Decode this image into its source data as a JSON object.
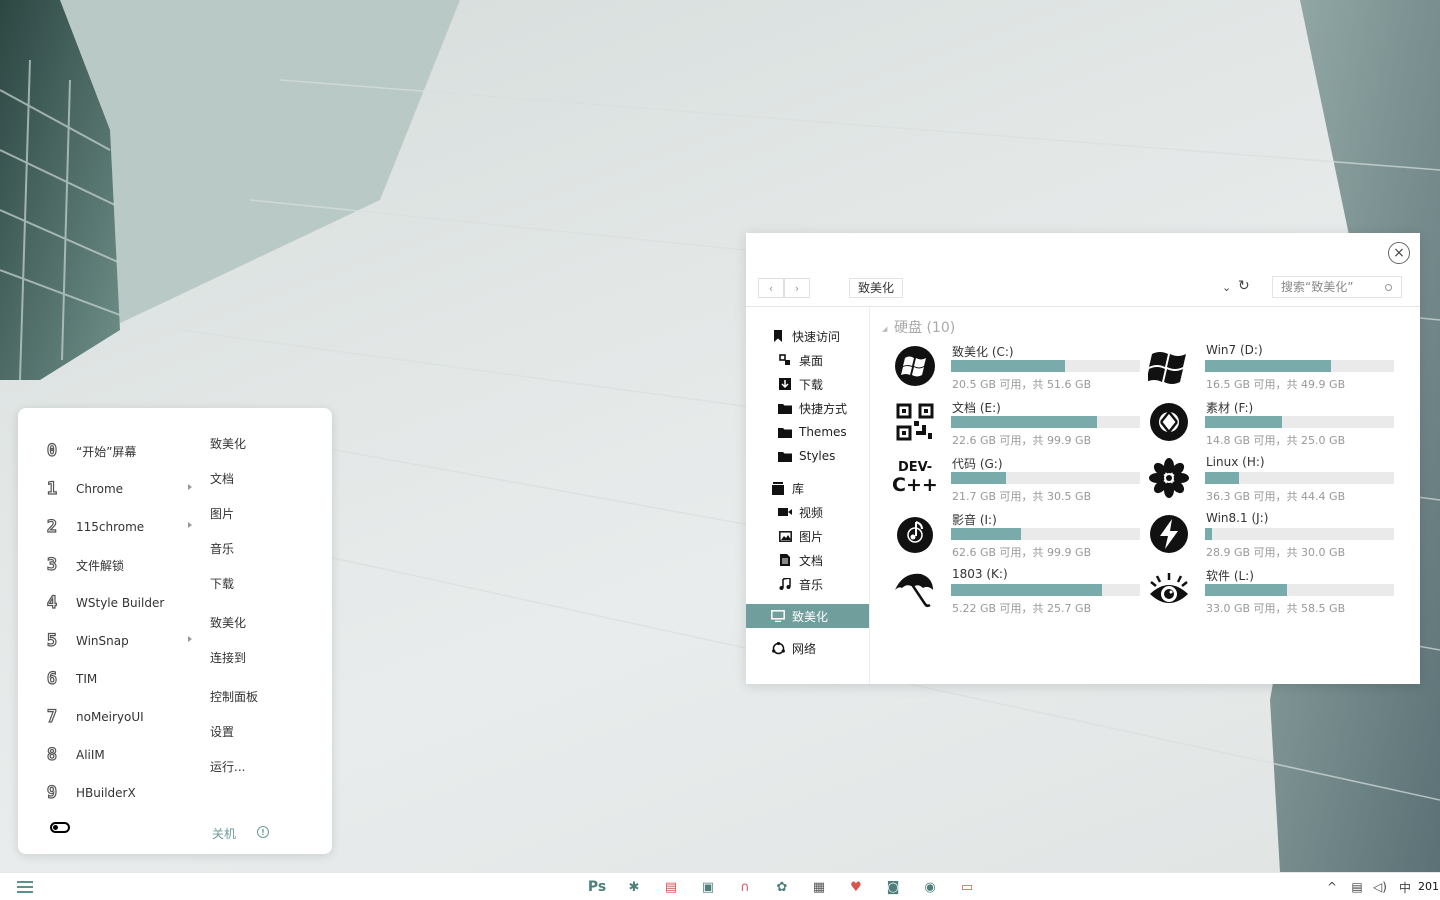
{
  "start_menu": {
    "apps": [
      {
        "num": "0",
        "label": "“开始”屏幕",
        "has_submenu": false
      },
      {
        "num": "1",
        "label": "Chrome",
        "has_submenu": true
      },
      {
        "num": "2",
        "label": "115chrome",
        "has_submenu": true
      },
      {
        "num": "3",
        "label": "文件解锁",
        "has_submenu": false
      },
      {
        "num": "4",
        "label": "WStyle Builder",
        "has_submenu": false
      },
      {
        "num": "5",
        "label": "WinSnap",
        "has_submenu": true
      },
      {
        "num": "6",
        "label": "TIM",
        "has_submenu": false
      },
      {
        "num": "7",
        "label": "noMeiryoUI",
        "has_submenu": false
      },
      {
        "num": "8",
        "label": "AliIM",
        "has_submenu": false
      },
      {
        "num": "9",
        "label": "HBuilderX",
        "has_submenu": false
      }
    ],
    "places": [
      "致美化",
      "文档",
      "图片",
      "音乐",
      "下载",
      "致美化",
      "连接到",
      "控制面板",
      "设置",
      "运行..."
    ],
    "shutdown_label": "关机",
    "info_glyph": "!"
  },
  "explorer": {
    "close_glyph": "×",
    "back_glyph": "‹",
    "forward_glyph": "›",
    "address": "致美化",
    "dropdown_glyph": "⌄",
    "refresh_glyph": "↻",
    "search_placeholder": "搜索“致美化”",
    "nav": {
      "quick_access": "快速访问",
      "desktop": "桌面",
      "downloads": "下载",
      "shortcuts": "快捷方式",
      "themes": "Themes",
      "styles": "Styles",
      "library": "库",
      "videos": "视频",
      "pictures": "图片",
      "documents": "文档",
      "music": "音乐",
      "this_pc": "致美化",
      "network": "网络"
    },
    "section_title": "硬盘 (10)",
    "accent_color": "#78aba9",
    "drives": [
      {
        "name": "致美化 (C:)",
        "free_text": "20.5 GB 可用，共 51.6 GB",
        "used_fraction": 0.603,
        "icon": "windows-orb-icon"
      },
      {
        "name": "Win7 (D:)",
        "free_text": "16.5 GB 可用，共 49.9 GB",
        "used_fraction": 0.669,
        "icon": "windows-flag-icon"
      },
      {
        "name": "文档 (E:)",
        "free_text": "22.6 GB 可用，共 99.9 GB",
        "used_fraction": 0.774,
        "icon": "qr-code-icon"
      },
      {
        "name": "素材 (F:)",
        "free_text": "14.8 GB 可用，共 25.0 GB",
        "used_fraction": 0.408,
        "icon": "aperture-icon"
      },
      {
        "name": "代码 (G:)",
        "free_text": "21.7 GB 可用，共 30.5 GB",
        "used_fraction": 0.289,
        "icon": "dev-cpp-icon",
        "icon_text_top": "DEV-",
        "icon_text_bottom": "C++"
      },
      {
        "name": "Linux (H:)",
        "free_text": "36.3 GB 可用，共 44.4 GB",
        "used_fraction": 0.182,
        "icon": "flower-icon"
      },
      {
        "name": "影音 (I:)",
        "free_text": "62.6 GB 可用，共 99.9 GB",
        "used_fraction": 0.373,
        "icon": "music-disc-icon"
      },
      {
        "name": "Win8.1 (J:)",
        "free_text": "28.9 GB 可用，共 30.0 GB",
        "used_fraction": 0.037,
        "icon": "lightning-icon"
      },
      {
        "name": "1803 (K:)",
        "free_text": "5.22 GB 可用，共 25.7 GB",
        "used_fraction": 0.797,
        "icon": "umbrella-icon"
      },
      {
        "name": "软件 (L:)",
        "free_text": "33.0 GB 可用，共 58.5 GB",
        "used_fraction": 0.436,
        "icon": "eye-icon"
      }
    ]
  },
  "taskbar": {
    "apps": [
      {
        "name": "photoshop-icon",
        "glyph": "Ps",
        "color": "#4f7f7d"
      },
      {
        "name": "settings-gear-icon",
        "glyph": "✱",
        "color": "#4f7f7d"
      },
      {
        "name": "firewall-icon",
        "glyph": "▤",
        "color": "#d9534f"
      },
      {
        "name": "terminal-icon",
        "glyph": "▣",
        "color": "#4f7f7d"
      },
      {
        "name": "headphones-icon",
        "glyph": "∩",
        "color": "#d05a6e"
      },
      {
        "name": "aperture-app-icon",
        "glyph": "✿",
        "color": "#4f7f7d"
      },
      {
        "name": "notepad-icon",
        "glyph": "▦",
        "color": "#555555"
      },
      {
        "name": "heart-icon",
        "glyph": "♥",
        "color": "#d9534f"
      },
      {
        "name": "camera-icon",
        "glyph": "◙",
        "color": "#4f7f7d"
      },
      {
        "name": "chrome-icon",
        "glyph": "◉",
        "color": "#4f7f7d"
      },
      {
        "name": "remote-desktop-icon",
        "glyph": "▭",
        "color": "#d9534f"
      }
    ],
    "tray": {
      "chevron": "^",
      "network": "▤",
      "volume": "◁)",
      "ime": "中"
    },
    "clock": "201"
  }
}
